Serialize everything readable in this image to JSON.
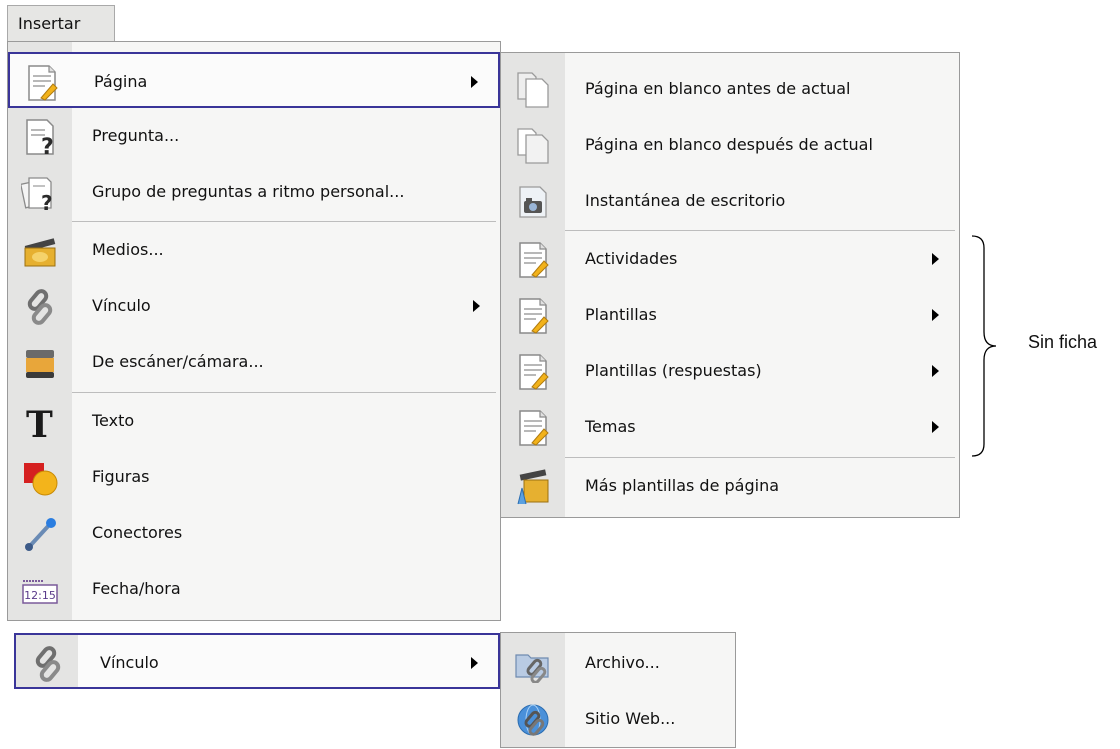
{
  "menubar": {
    "insert_label": "Insertar"
  },
  "main_menu": {
    "items": [
      {
        "label": "Página",
        "icon": "page-icon",
        "submenu": true
      },
      {
        "label": "Pregunta...",
        "icon": "question-icon"
      },
      {
        "label": "Grupo de preguntas a ritmo personal...",
        "icon": "question-group-icon"
      },
      {
        "label": "Medios...",
        "icon": "media-icon"
      },
      {
        "label": "Vínculo",
        "icon": "link-icon",
        "submenu": true
      },
      {
        "label": "De escáner/cámara...",
        "icon": "scanner-icon"
      },
      {
        "label": "Texto",
        "icon": "text-icon"
      },
      {
        "label": "Figuras",
        "icon": "shapes-icon"
      },
      {
        "label": "Conectores",
        "icon": "connector-icon"
      },
      {
        "label": "Fecha/hora",
        "icon": "datetime-icon"
      }
    ],
    "date_icon_text": "12:15"
  },
  "page_submenu": {
    "items": [
      {
        "label": "Página en blanco antes de actual",
        "icon": "blank-page-before-icon"
      },
      {
        "label": "Página en blanco después de actual",
        "icon": "blank-page-after-icon"
      },
      {
        "label": "Instantánea de escritorio",
        "icon": "desktop-snapshot-icon"
      },
      {
        "label": "Actividades",
        "icon": "page-icon",
        "submenu": true
      },
      {
        "label": "Plantillas",
        "icon": "page-icon",
        "submenu": true
      },
      {
        "label": "Plantillas (respuestas)",
        "icon": "page-icon",
        "submenu": true
      },
      {
        "label": "Temas",
        "icon": "page-icon",
        "submenu": true
      },
      {
        "label": "Más plantillas de página",
        "icon": "more-templates-icon"
      }
    ]
  },
  "link_menu": {
    "label": "Vínculo",
    "icon": "link-icon",
    "submenu_items": [
      {
        "label": "Archivo...",
        "icon": "file-link-icon"
      },
      {
        "label": "Sitio Web...",
        "icon": "web-link-icon"
      }
    ]
  },
  "annotation": {
    "label": "Sin ficha"
  },
  "colors": {
    "highlight_border": "#3a3599",
    "gutter": "#e4e4e3",
    "menu_bg": "#f6f6f5"
  }
}
